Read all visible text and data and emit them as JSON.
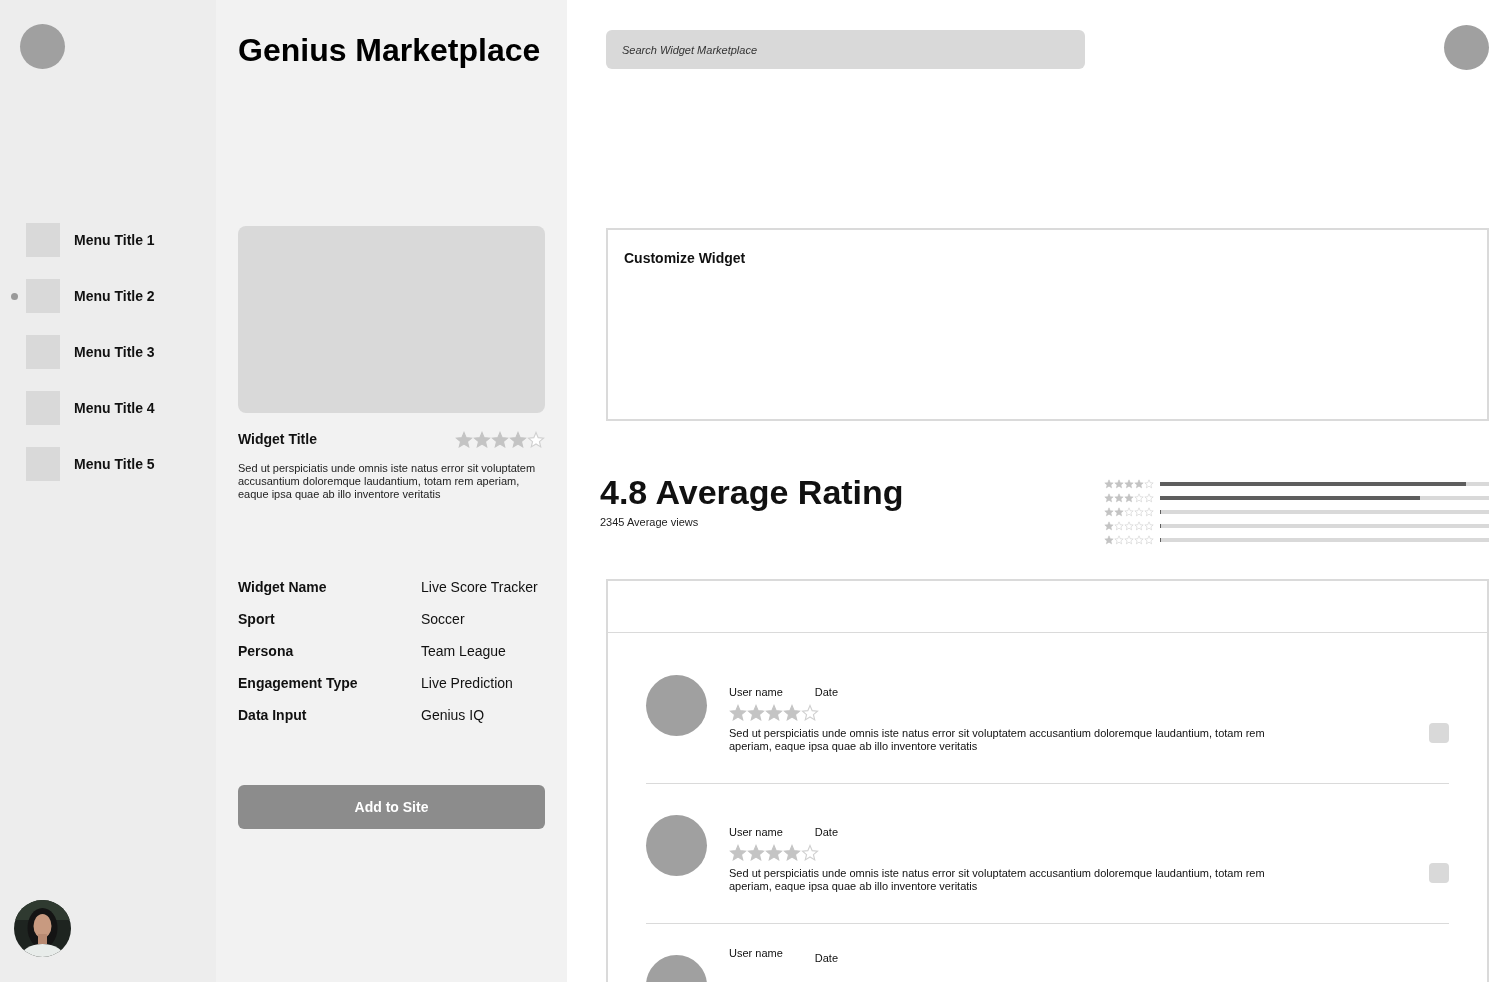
{
  "sidebar": {
    "items": [
      {
        "label": "Menu Title 1",
        "selected": false
      },
      {
        "label": "Menu Title 2",
        "selected": true
      },
      {
        "label": "Menu Title 3",
        "selected": false
      },
      {
        "label": "Menu Title 4",
        "selected": false
      },
      {
        "label": "Menu Title 5",
        "selected": false
      }
    ]
  },
  "title": "Genius Marketplace",
  "widget": {
    "title": "Widget Title",
    "stars": 4,
    "description": "Sed ut perspiciatis unde omnis iste natus error sit voluptatem accusantium doloremque laudantium, totam rem aperiam, eaque ipsa quae ab illo inventore veritatis",
    "details": [
      {
        "label": "Widget Name",
        "value": "Live Score Tracker"
      },
      {
        "label": "Sport",
        "value": "Soccer"
      },
      {
        "label": "Persona",
        "value": "Team League"
      },
      {
        "label": "Engagement Type",
        "value": "Live Prediction"
      },
      {
        "label": "Data Input",
        "value": "Genius IQ"
      }
    ],
    "button": "Add to Site"
  },
  "search": {
    "placeholder": "Search Widget Marketplace"
  },
  "customize": {
    "title": "Customize Widget"
  },
  "rating": {
    "headline": "4.8 Average Rating",
    "subtitle": "2345 Average views",
    "breakdown": [
      {
        "stars": 4,
        "level": 0.93
      },
      {
        "stars": 3,
        "level": 0.79
      },
      {
        "stars": 2,
        "level": 0
      },
      {
        "stars": 1,
        "level": 0
      },
      {
        "stars": 1,
        "level": 0
      }
    ]
  },
  "reviews": [
    {
      "user": "User name",
      "date": "Date",
      "stars": 4,
      "text": "Sed ut perspiciatis unde omnis iste natus error sit voluptatem accusantium doloremque laudantium, totam rem aperiam, eaque ipsa quae ab illo inventore veritatis"
    },
    {
      "user": "User name",
      "date": "Date",
      "stars": 4,
      "text": "Sed ut perspiciatis unde omnis iste natus error sit voluptatem accusantium doloremque laudantium, totam rem aperiam, eaque ipsa quae ab illo inventore veritatis"
    },
    {
      "user": "User name",
      "date": "Date"
    }
  ]
}
